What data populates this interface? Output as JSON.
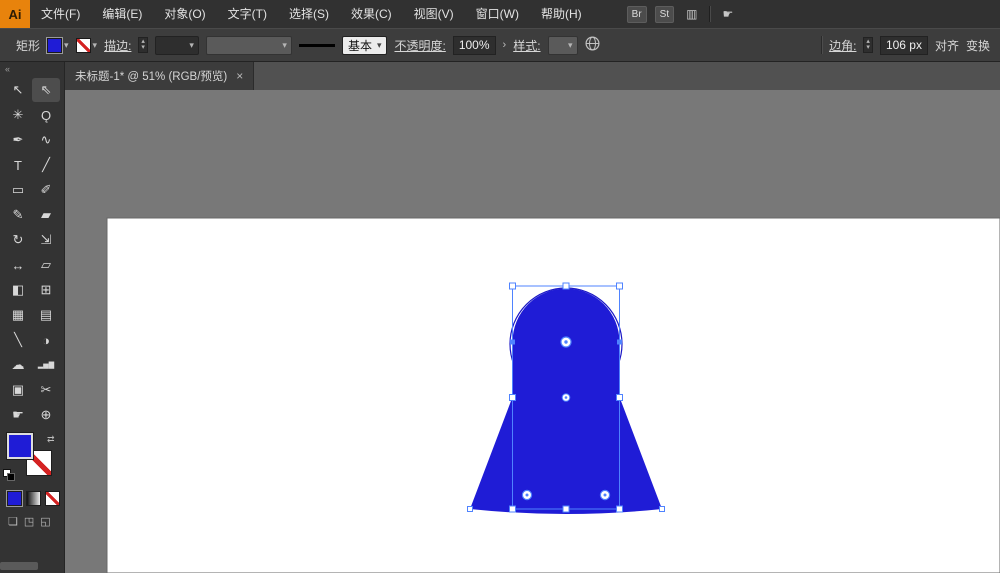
{
  "menu_bar": {
    "logo_text": "Ai",
    "items": [
      "文件(F)",
      "编辑(E)",
      "对象(O)",
      "文字(T)",
      "选择(S)",
      "效果(C)",
      "视图(V)",
      "窗口(W)",
      "帮助(H)"
    ],
    "bridge_badge": "Br",
    "stock_badge": "St",
    "workspace_icon_glyph": "▥",
    "hand_icon_glyph": "☛"
  },
  "control_bar": {
    "tool_label": "矩形",
    "stroke_label": "描边:",
    "profile_label": "基本",
    "opacity_label": "不透明度:",
    "opacity_value": "100%",
    "opacity_chevron": "›",
    "style_label": "样式:",
    "corner_label": "边角:",
    "corner_value": "106 px",
    "align_label": "对齐",
    "transform_label": "变换"
  },
  "tab": {
    "title": "未标题-1* @ 51% (RGB/预览)",
    "close_glyph": "×"
  },
  "toolbar": {
    "collapse_glyph": "«",
    "tools": [
      {
        "name": "selection-tool",
        "glyph": "↖"
      },
      {
        "name": "direct-selection-tool",
        "glyph": "⇖"
      },
      {
        "name": "magic-wand-tool",
        "glyph": "✳"
      },
      {
        "name": "lasso-tool",
        "glyph": "Ǫ"
      },
      {
        "name": "pen-tool",
        "glyph": "✒"
      },
      {
        "name": "curvature-tool",
        "glyph": "∿"
      },
      {
        "name": "type-tool",
        "glyph": "T"
      },
      {
        "name": "line-tool",
        "glyph": "╱"
      },
      {
        "name": "rectangle-tool",
        "glyph": "▭"
      },
      {
        "name": "paintbrush-tool",
        "glyph": "✐"
      },
      {
        "name": "pencil-tool",
        "glyph": "✎"
      },
      {
        "name": "eraser-tool",
        "glyph": "▰"
      },
      {
        "name": "rotate-tool",
        "glyph": "↻"
      },
      {
        "name": "scale-tool",
        "glyph": "⇲"
      },
      {
        "name": "width-tool",
        "glyph": "↔"
      },
      {
        "name": "free-transform-tool",
        "glyph": "▱"
      },
      {
        "name": "shape-builder-tool",
        "glyph": "◧"
      },
      {
        "name": "perspective-grid-tool",
        "glyph": "⊞"
      },
      {
        "name": "mesh-tool",
        "glyph": "▦"
      },
      {
        "name": "gradient-tool",
        "glyph": "▤"
      },
      {
        "name": "eyedropper-tool",
        "glyph": "╲"
      },
      {
        "name": "blend-tool",
        "glyph": "◑"
      },
      {
        "name": "symbol-sprayer-tool",
        "glyph": "☁"
      },
      {
        "name": "graph-tool",
        "glyph": "▂▅▇"
      },
      {
        "name": "artboard-tool",
        "glyph": "▣"
      },
      {
        "name": "slice-tool",
        "glyph": "✂"
      },
      {
        "name": "hand-tool",
        "glyph": "☛"
      },
      {
        "name": "zoom-tool",
        "glyph": "⊕"
      }
    ],
    "swap_icon_glyph": "⇄"
  },
  "colors": {
    "fill_blue": "#1f1cd6",
    "construction_stroke_blue": "#1b18c6",
    "selection_blue": "#4f83ff",
    "canvas_gray": "#787878",
    "artboard_white": "#ffffff"
  }
}
